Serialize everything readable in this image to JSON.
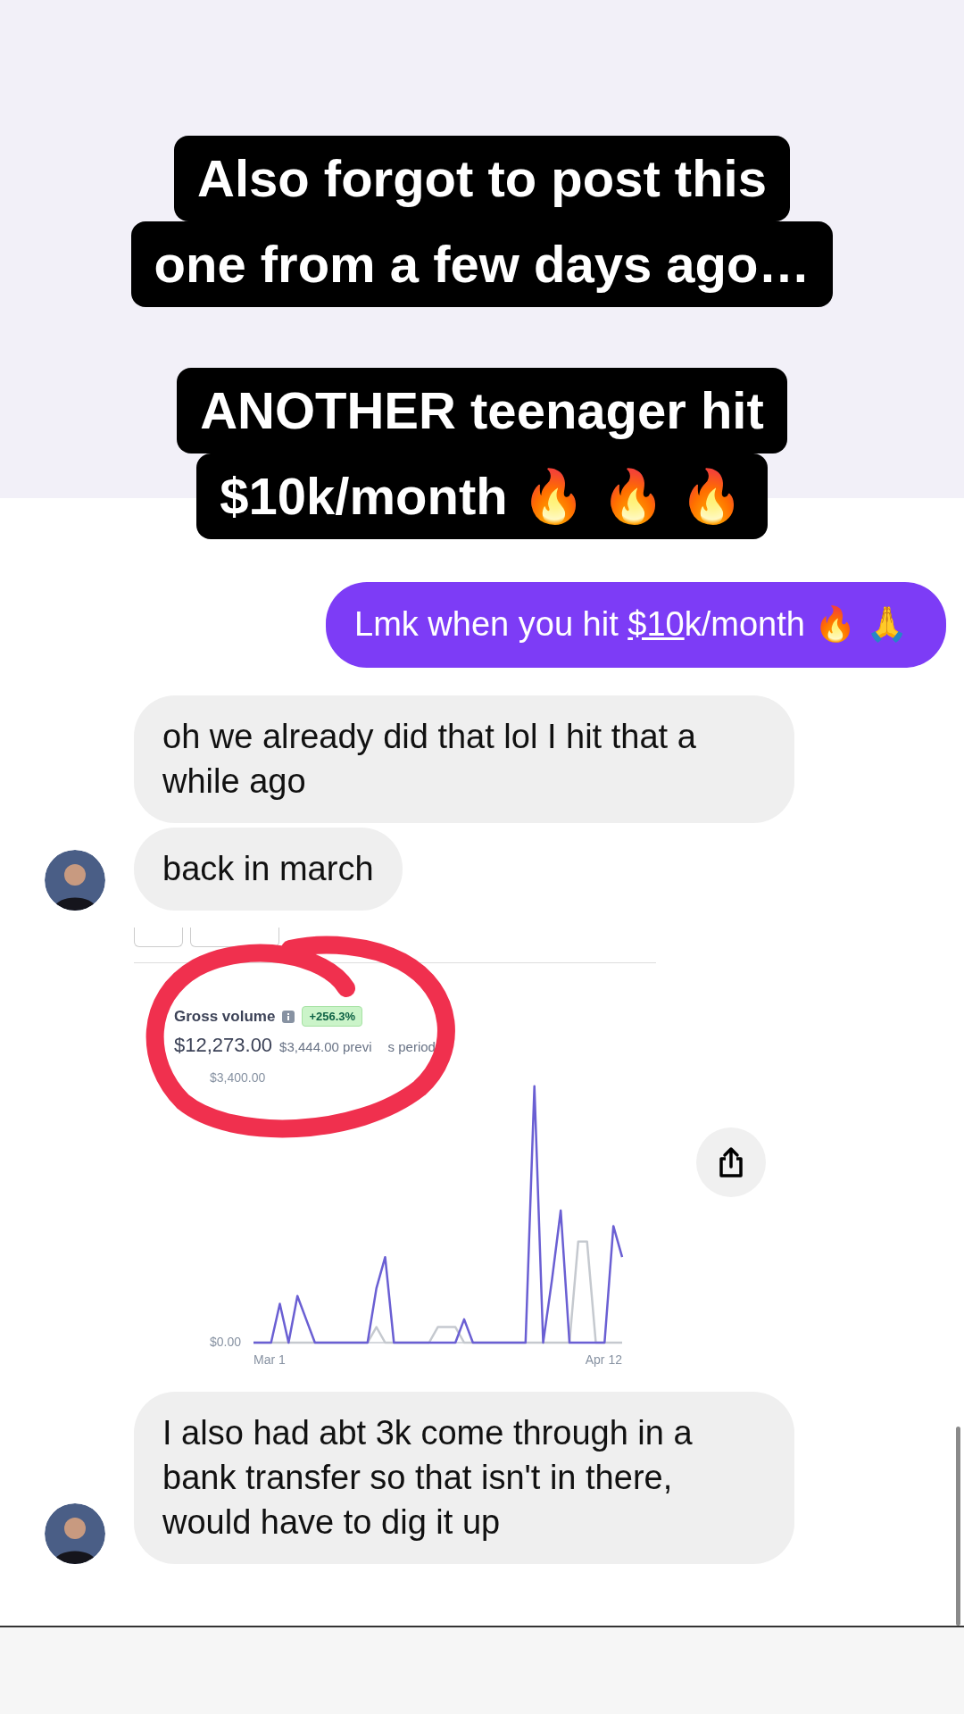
{
  "captions": [
    {
      "lines": [
        "Also forgot to post this",
        "one from a few days ago…"
      ]
    },
    {
      "lines": [
        "ANOTHER teenager hit",
        "$10k/month 🔥 🔥 🔥"
      ]
    }
  ],
  "messages": [
    {
      "kind": "sent",
      "text_before": "Lmk when you hit ",
      "link": "$10",
      "text_after": "k/month 🔥 🙏"
    },
    {
      "kind": "received",
      "text": "oh we already did that lol I hit that a while ago",
      "avatar": false
    },
    {
      "kind": "received",
      "text": "back in march",
      "avatar": true
    },
    {
      "kind": "chart",
      "title": "Gross volume",
      "change": "+256.3%",
      "amount": "$12,273.00",
      "previous": [
        "$3,444.00 previ",
        "s period"
      ],
      "x_axis_labels": [
        "Mar 1",
        "Apr 12"
      ],
      "chart_data": {
        "type": "line",
        "yticks": [
          {
            "value": 0,
            "label": "$0.00"
          },
          {
            "value": 3400,
            "label": "$3,400.00"
          }
        ],
        "ylim": [
          0,
          3400
        ],
        "series": [
          {
            "color": "#6a5fd3",
            "values": [
              0,
              0,
              0,
              500,
              0,
              600,
              300,
              0,
              0,
              0,
              0,
              0,
              0,
              0,
              700,
              1100,
              0,
              0,
              0,
              0,
              0,
              0,
              0,
              0,
              300,
              0,
              0,
              0,
              0,
              0,
              0,
              0,
              3300,
              0,
              800,
              1700,
              0,
              0,
              0,
              0,
              0,
              1500,
              1100
            ]
          },
          {
            "color": "#c5c9cf",
            "values": [
              0,
              0,
              0,
              0,
              0,
              0,
              0,
              0,
              0,
              0,
              0,
              0,
              0,
              0,
              200,
              0,
              0,
              0,
              0,
              0,
              0,
              200,
              200,
              200,
              0,
              0,
              0,
              0,
              0,
              0,
              0,
              0,
              0,
              0,
              0,
              0,
              0,
              1300,
              1300,
              0,
              0,
              0,
              0
            ]
          }
        ]
      }
    },
    {
      "kind": "received",
      "text": "I also had abt 3k come through in a bank transfer so that isn't in there, would have to dig it up",
      "avatar": true
    }
  ]
}
